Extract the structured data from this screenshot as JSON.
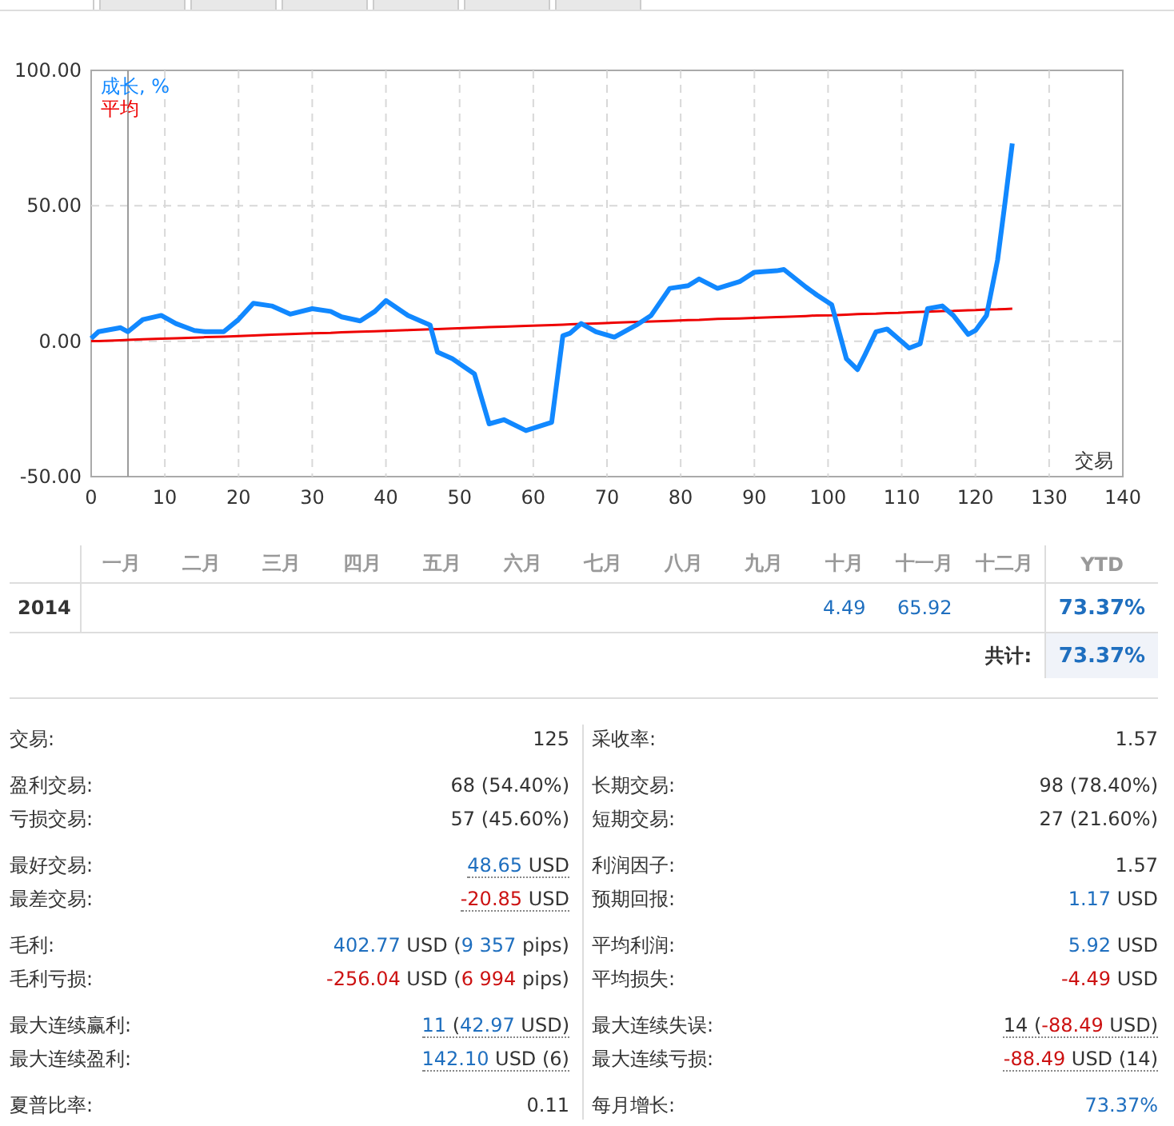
{
  "tabs": [
    {
      "selected": true
    },
    {
      "selected": false
    },
    {
      "selected": false
    },
    {
      "selected": false
    },
    {
      "selected": false
    },
    {
      "selected": false
    },
    {
      "selected": false
    }
  ],
  "chart": {
    "chart_data": {
      "type": "line",
      "xlabel": "交易",
      "x": [
        0,
        1,
        4,
        5,
        7,
        9.5,
        11.5,
        14,
        15.5,
        18,
        20,
        22,
        24.5,
        27,
        30,
        32.5,
        34,
        36.5,
        38.5,
        40,
        43,
        46,
        47,
        49,
        52,
        54,
        56,
        59,
        62.5,
        64,
        65,
        66.5,
        68.5,
        71,
        74,
        76,
        78.5,
        81,
        82.5,
        85,
        88,
        90,
        93,
        94,
        97,
        98.5,
        100.5,
        102.5,
        104,
        105,
        106.5,
        108,
        109.5,
        111,
        112.5,
        113.5,
        115.5,
        117,
        119,
        120,
        121.5,
        123,
        124,
        125
      ],
      "series": [
        {
          "name": "成长, %",
          "color": "#1188ff",
          "values": [
            1,
            3.5,
            5,
            3.5,
            8,
            9.5,
            6.5,
            4,
            3.5,
            3.5,
            8,
            14,
            13,
            10,
            12,
            11,
            9,
            7.5,
            11,
            15,
            9.5,
            6,
            -4,
            -6.5,
            -12,
            -30.5,
            -29,
            -33,
            -30,
            2,
            3,
            6.5,
            3.5,
            1.5,
            6,
            9.5,
            19.5,
            20.5,
            23,
            19.5,
            22,
            25.5,
            26,
            26.5,
            20,
            17,
            13.5,
            -6.5,
            -10.5,
            -5,
            3.5,
            4.5,
            1,
            -2.5,
            -1,
            12,
            13,
            9.5,
            2.5,
            4,
            9.5,
            30,
            51,
            73
          ]
        },
        {
          "name": "平均",
          "color": "#ee0000",
          "values": [
            0,
            0.1,
            0.4,
            0.5,
            0.7,
            0.9,
            1.1,
            1.3,
            1.5,
            1.7,
            1.9,
            2.1,
            2.4,
            2.6,
            2.9,
            3.1,
            3.3,
            3.5,
            3.7,
            3.8,
            4.1,
            4.4,
            4.5,
            4.7,
            5,
            5.2,
            5.4,
            5.7,
            6,
            6.1,
            6.2,
            6.4,
            6.6,
            6.8,
            7.1,
            7.3,
            7.5,
            7.8,
            7.9,
            8.2,
            8.4,
            8.6,
            8.9,
            9,
            9.3,
            9.5,
            9.6,
            9.8,
            10,
            10.1,
            10.2,
            10.4,
            10.5,
            10.7,
            10.8,
            10.9,
            11.1,
            11.2,
            11.4,
            11.5,
            11.7,
            11.8,
            11.9,
            12
          ]
        }
      ],
      "xlim": [
        0,
        140
      ],
      "ylim": [
        -50,
        100
      ],
      "xticks": [
        0,
        10,
        20,
        30,
        40,
        50,
        60,
        70,
        80,
        90,
        100,
        110,
        120,
        130,
        140
      ],
      "yticks": [
        {
          "value": -50,
          "label": "-50.00"
        },
        {
          "value": 0,
          "label": "0.00"
        },
        {
          "value": 50,
          "label": "50.00"
        },
        {
          "value": 100,
          "label": "100.00"
        }
      ],
      "grid": true,
      "ref_lines": [
        {
          "axis": "x",
          "value": 5
        }
      ]
    }
  },
  "monthly": {
    "columns": [
      "一月",
      "二月",
      "三月",
      "四月",
      "五月",
      "六月",
      "七月",
      "八月",
      "九月",
      "十月",
      "十一月",
      "十二月"
    ],
    "total_header": "YTD",
    "rows": [
      {
        "year": "2014",
        "cells": [
          "",
          "",
          "",
          "",
          "",
          "",
          "",
          "",
          "",
          "4.49",
          "65.92",
          ""
        ],
        "total": "73.37%"
      }
    ],
    "footer": {
      "label": "共计:",
      "total": "73.37%"
    }
  },
  "stats": [
    [
      [
        {
          "label": "交易:",
          "underlined": false,
          "parts": [
            {
              "text": "125",
              "kind": "plain"
            }
          ]
        }
      ],
      [
        {
          "label": "盈利交易:",
          "underlined": false,
          "parts": [
            {
              "text": "68 (54.40%)",
              "kind": "plain"
            }
          ]
        },
        {
          "label": "亏损交易:",
          "underlined": false,
          "parts": [
            {
              "text": "57 (45.60%)",
              "kind": "plain"
            }
          ]
        }
      ],
      [
        {
          "label": "最好交易:",
          "underlined": true,
          "parts": [
            {
              "text": "48.65",
              "kind": "positive"
            },
            {
              "text": " USD",
              "kind": "plain"
            }
          ]
        },
        {
          "label": "最差交易:",
          "underlined": true,
          "parts": [
            {
              "text": "-20.85",
              "kind": "negative"
            },
            {
              "text": " USD",
              "kind": "plain"
            }
          ]
        }
      ],
      [
        {
          "label": "毛利:",
          "underlined": false,
          "parts": [
            {
              "text": "402.77",
              "kind": "positive"
            },
            {
              "text": " USD (",
              "kind": "plain"
            },
            {
              "text": "9 357",
              "kind": "positive"
            },
            {
              "text": " pips)",
              "kind": "plain"
            }
          ]
        },
        {
          "label": "毛利亏损:",
          "underlined": false,
          "parts": [
            {
              "text": "-256.04",
              "kind": "negative"
            },
            {
              "text": " USD (",
              "kind": "plain"
            },
            {
              "text": "6 994",
              "kind": "negative"
            },
            {
              "text": " pips)",
              "kind": "plain"
            }
          ]
        }
      ],
      [
        {
          "label": "最大连续赢利:",
          "underlined": true,
          "parts": [
            {
              "text": "11",
              "kind": "positive"
            },
            {
              "text": " (",
              "kind": "plain"
            },
            {
              "text": "42.97",
              "kind": "positive"
            },
            {
              "text": " USD)",
              "kind": "plain"
            }
          ]
        },
        {
          "label": "最大连续盈利:",
          "underlined": true,
          "parts": [
            {
              "text": "142.10",
              "kind": "positive"
            },
            {
              "text": " USD (6)",
              "kind": "plain"
            }
          ]
        }
      ],
      [
        {
          "label": "夏普比率:",
          "underlined": false,
          "parts": [
            {
              "text": "0.11",
              "kind": "plain"
            }
          ]
        }
      ]
    ],
    [
      [
        {
          "label": "采收率:",
          "underlined": false,
          "parts": [
            {
              "text": "1.57",
              "kind": "plain"
            }
          ]
        }
      ],
      [
        {
          "label": "长期交易:",
          "underlined": false,
          "parts": [
            {
              "text": "98 (78.40%)",
              "kind": "plain"
            }
          ]
        },
        {
          "label": "短期交易:",
          "underlined": false,
          "parts": [
            {
              "text": "27 (21.60%)",
              "kind": "plain"
            }
          ]
        }
      ],
      [
        {
          "label": "利润因子:",
          "underlined": false,
          "parts": [
            {
              "text": "1.57",
              "kind": "plain"
            }
          ]
        },
        {
          "label": "预期回报:",
          "underlined": false,
          "parts": [
            {
              "text": "1.17",
              "kind": "positive"
            },
            {
              "text": " USD",
              "kind": "plain"
            }
          ]
        }
      ],
      [
        {
          "label": "平均利润:",
          "underlined": false,
          "parts": [
            {
              "text": "5.92",
              "kind": "positive"
            },
            {
              "text": " USD",
              "kind": "plain"
            }
          ]
        },
        {
          "label": "平均损失:",
          "underlined": false,
          "parts": [
            {
              "text": "-4.49",
              "kind": "negative"
            },
            {
              "text": " USD",
              "kind": "plain"
            }
          ]
        }
      ],
      [
        {
          "label": "最大连续失误:",
          "underlined": true,
          "parts": [
            {
              "text": "14 (",
              "kind": "plain"
            },
            {
              "text": "-88.49",
              "kind": "negative"
            },
            {
              "text": " USD)",
              "kind": "plain"
            }
          ]
        },
        {
          "label": "最大连续亏损:",
          "underlined": true,
          "parts": [
            {
              "text": "-88.49",
              "kind": "negative"
            },
            {
              "text": " USD (14)",
              "kind": "plain"
            }
          ]
        }
      ],
      [
        {
          "label": "每月增长:",
          "underlined": false,
          "parts": [
            {
              "text": "73.37%",
              "kind": "positive"
            }
          ]
        }
      ]
    ]
  ]
}
